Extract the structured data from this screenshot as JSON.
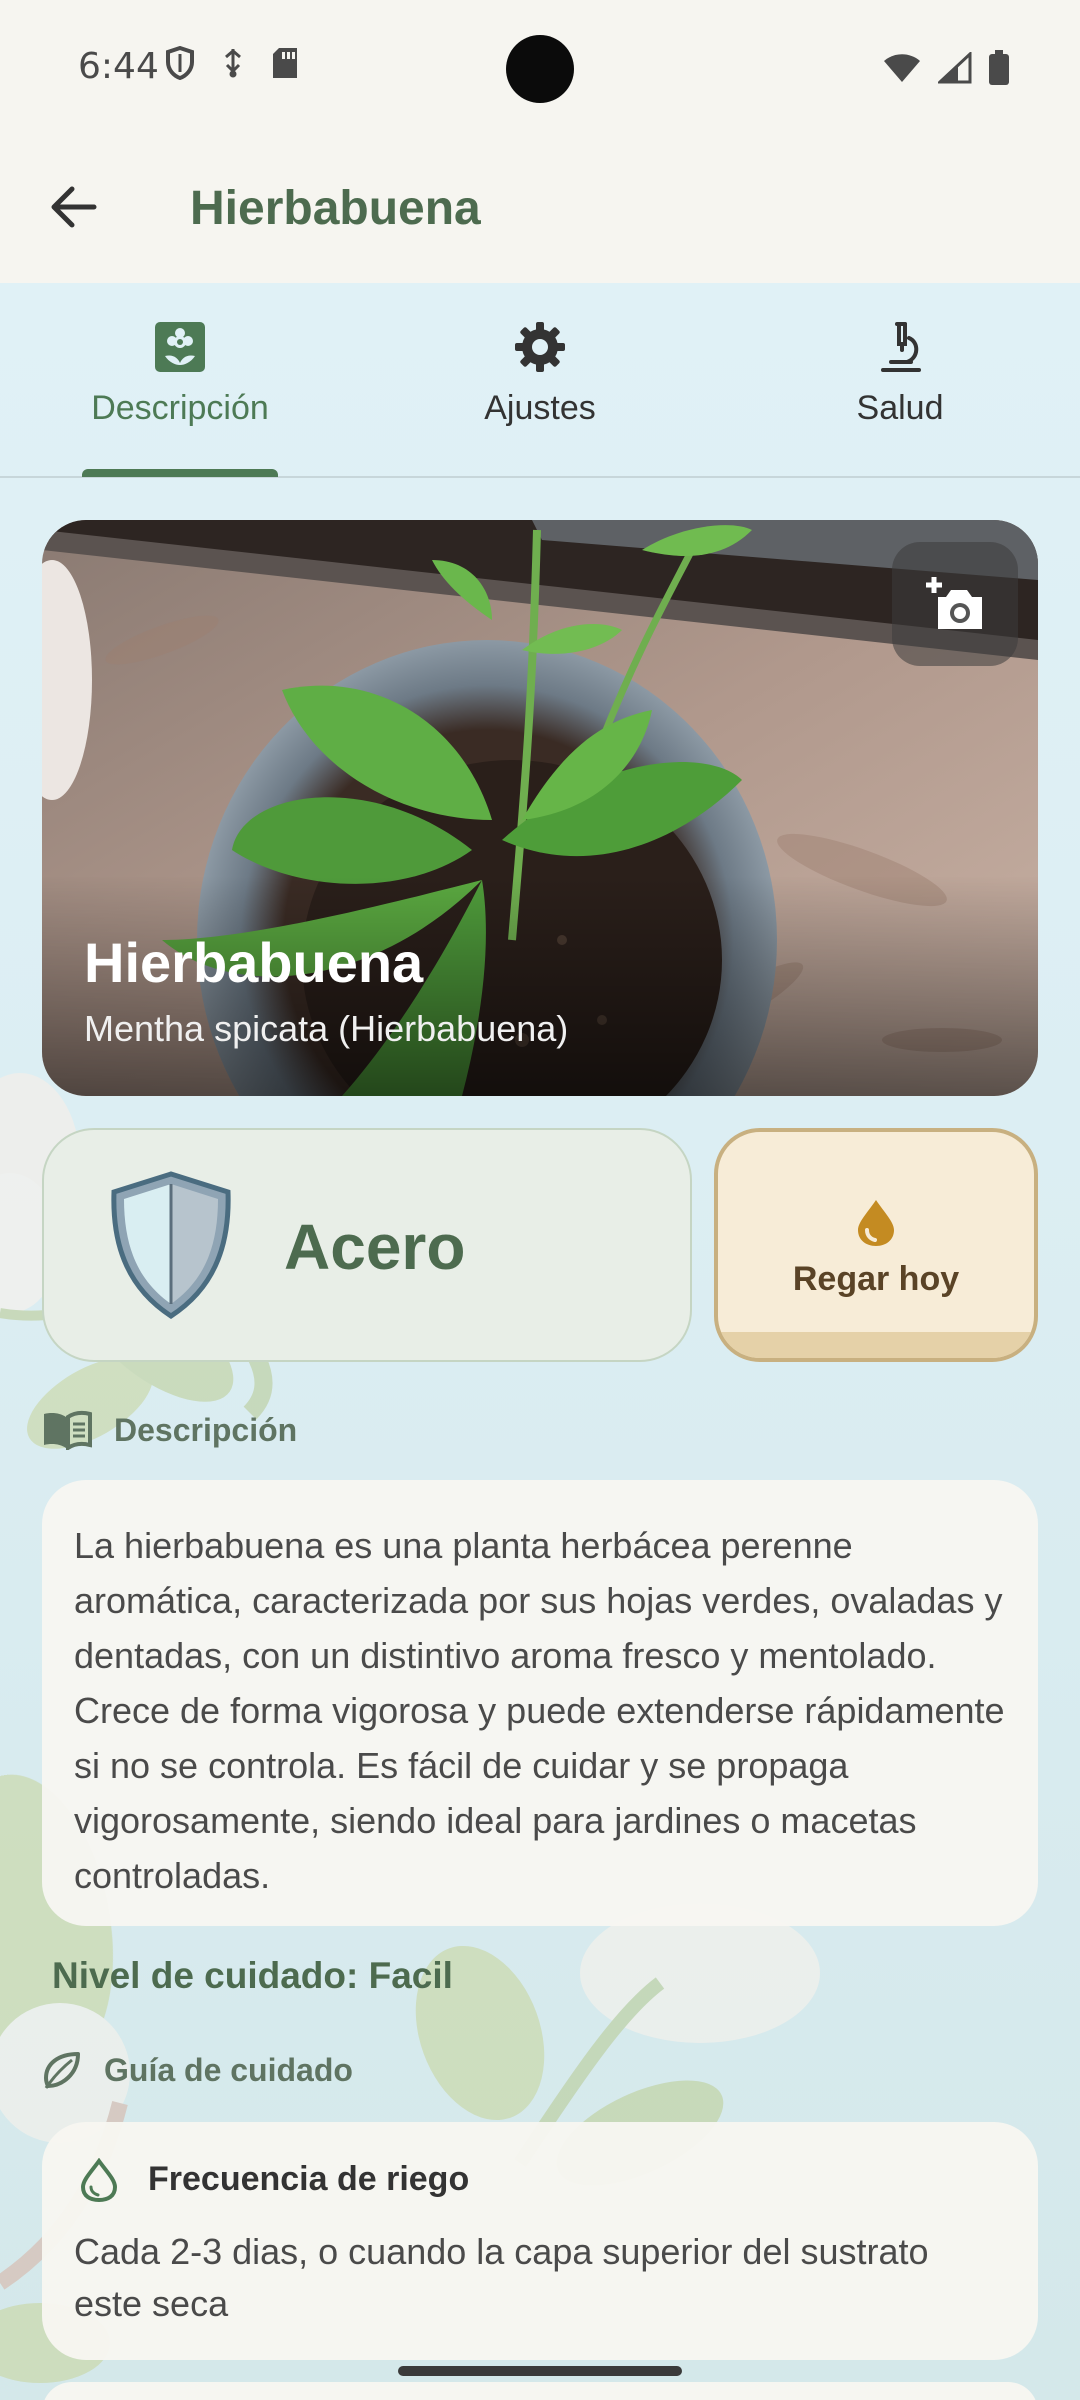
{
  "status_bar": {
    "time": "6:44",
    "left_icons": [
      "shield-icon",
      "usb-icon",
      "sd-card-icon"
    ],
    "right_icons": [
      "wifi-icon",
      "cell-signal-icon",
      "battery-icon"
    ]
  },
  "app_bar": {
    "title": "Hierbabuena",
    "back_icon": "arrow-back-icon"
  },
  "tabs": [
    {
      "label": "Descripción",
      "icon": "flower-card-icon",
      "active": true
    },
    {
      "label": "Ajustes",
      "icon": "gear-icon",
      "active": false
    },
    {
      "label": "Salud",
      "icon": "microscope-icon",
      "active": false
    }
  ],
  "hero": {
    "name": "Hierbabuena",
    "scientific": "Mentha spicata (Hierbabuena)",
    "camera_icon": "add-photo-icon"
  },
  "level_card": {
    "level": "Acero",
    "icon": "shield-badge-icon"
  },
  "water_button": {
    "label": "Regar hoy",
    "icon": "water-drop-icon"
  },
  "description_section": {
    "header": "Descripción",
    "icon": "book-icon",
    "text": "La hierbabuena es una planta herbácea perenne aromática, caracterizada por sus hojas verdes, ovaladas y dentadas, con un distintivo aroma fresco y mentolado. Crece de forma vigorosa y puede extenderse rápidamente si no se controla. Es fácil de cuidar y se propaga vigorosamente, siendo ideal para jardines o macetas controladas."
  },
  "care_level": "Nivel de cuidado: Facil",
  "care_guide": {
    "header": "Guía de cuidado",
    "icon": "leaf-icon",
    "items": [
      {
        "title": "Frecuencia de riego",
        "icon": "water-drop-outline-icon",
        "text": "Cada 2-3 dias, o cuando la capa superior del sustrato este seca"
      }
    ]
  },
  "colors": {
    "accent": "#4d7a55",
    "title_green": "#4d6b4f",
    "water_button_bg": "#f7ecd7",
    "water_button_border": "#c8b080",
    "background_tint": "#e0f1f6"
  }
}
